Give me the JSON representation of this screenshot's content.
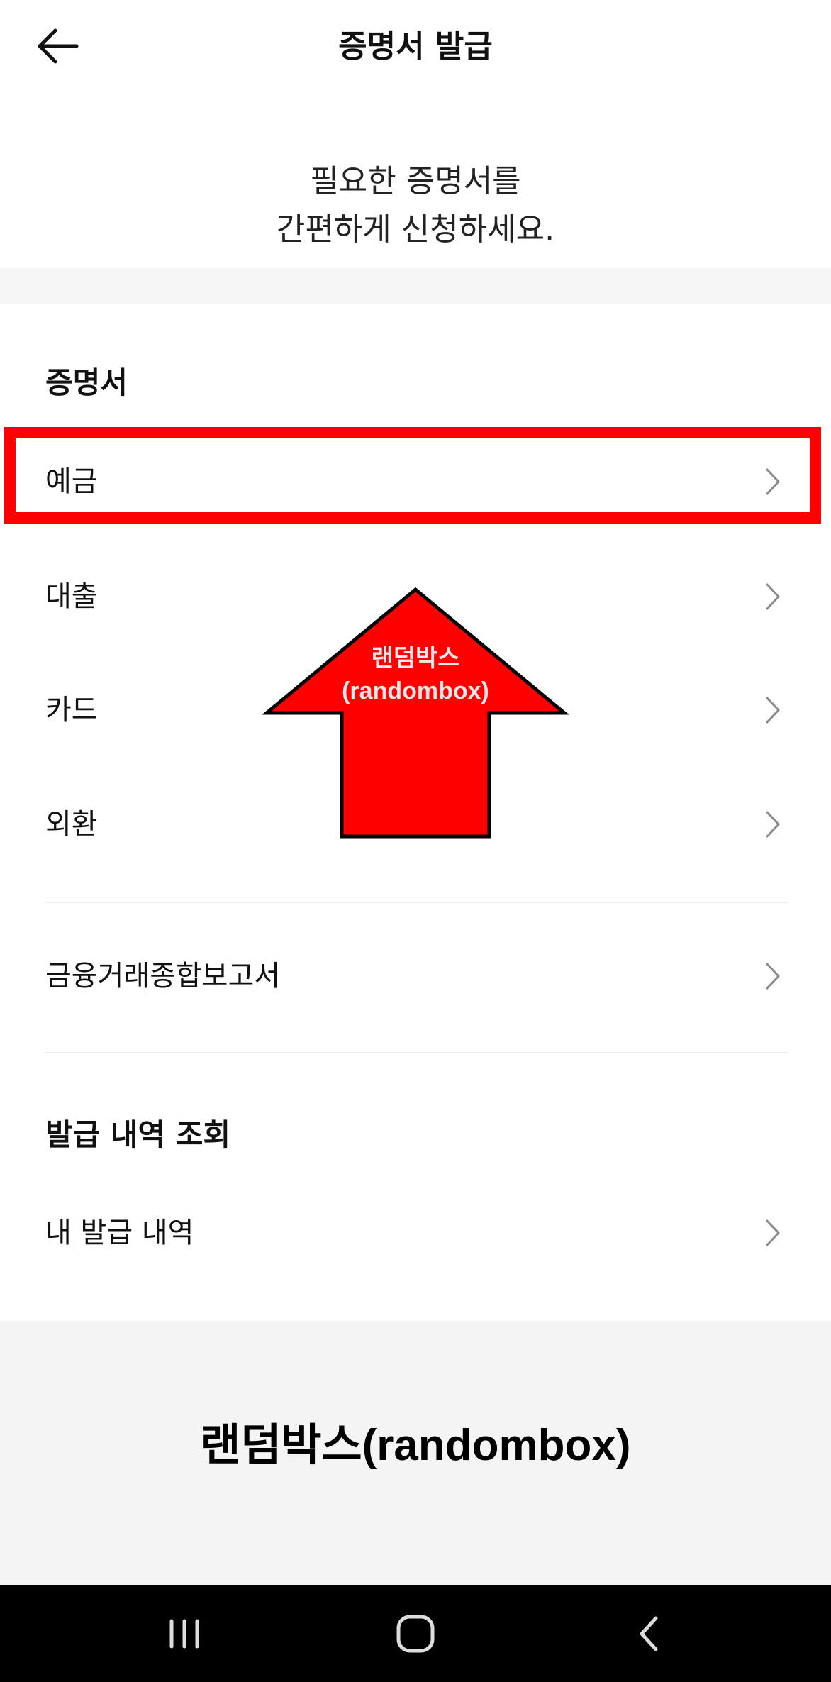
{
  "header": {
    "title": "증명서 발급",
    "back_icon": "arrow-left-icon"
  },
  "intro": {
    "line1": "필요한 증명서를",
    "line2": "간편하게 신청하세요."
  },
  "certificates": {
    "section_title": "증명서",
    "items": [
      {
        "label": "예금"
      },
      {
        "label": "대출"
      },
      {
        "label": "카드"
      },
      {
        "label": "외환"
      }
    ]
  },
  "report": {
    "label": "금융거래종합보고서"
  },
  "history": {
    "section_title": "발급 내역 조회",
    "items": [
      {
        "label": "내 발급 내역"
      }
    ]
  },
  "annotation": {
    "arrow_line1": "랜덤박스",
    "arrow_line2": "(randombox)",
    "highlight_color": "#ff0000",
    "watermark": "랜덤박스(randombox)"
  },
  "system_nav": {
    "recents_icon": "recents-icon",
    "home_icon": "home-icon",
    "back_icon": "back-chevron-icon"
  }
}
